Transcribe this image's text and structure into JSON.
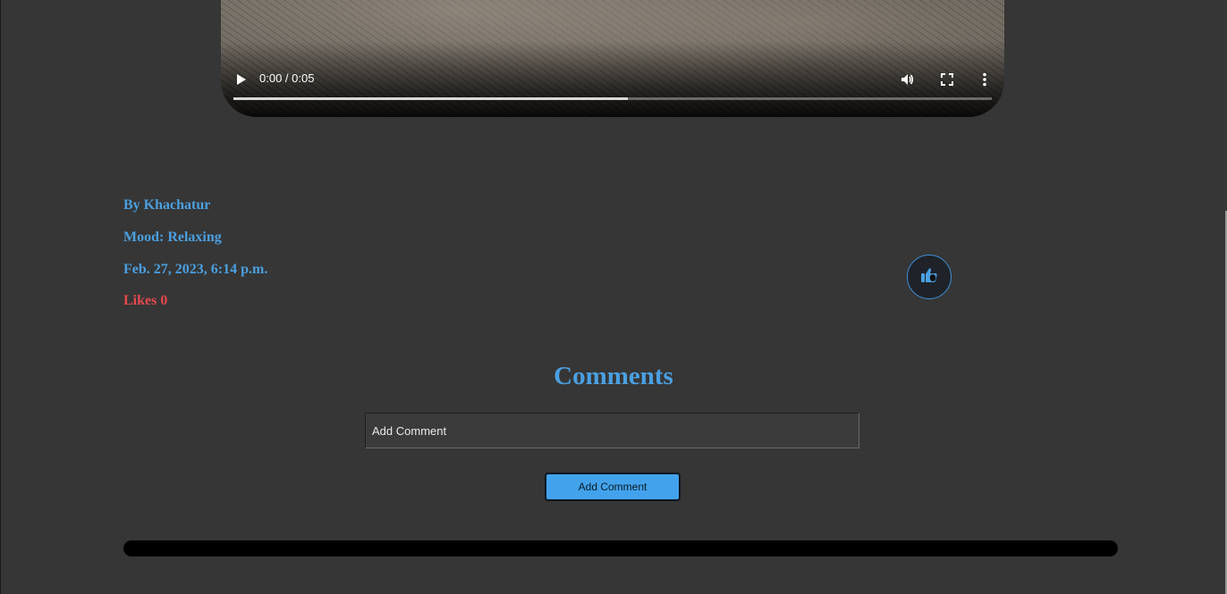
{
  "video": {
    "time": "0:00 / 0:05",
    "buffered_fraction": 0.52
  },
  "post": {
    "author": "By Khachatur",
    "mood": "Mood: Relaxing",
    "date": "Feb. 27, 2023, 6:14 p.m.",
    "likes": "Likes 0"
  },
  "comments": {
    "title": "Comments",
    "input_placeholder": "Add Comment",
    "submit_label": "Add Comment"
  },
  "colors": {
    "background": "#363636",
    "accent": "#4a9fe0",
    "likes": "#e5484d",
    "button": "#42a3ec"
  },
  "icons": {
    "like": "thumbs-up-icon",
    "play": "play-icon",
    "volume": "volume-icon",
    "fullscreen": "fullscreen-icon",
    "more": "more-vertical-icon"
  }
}
